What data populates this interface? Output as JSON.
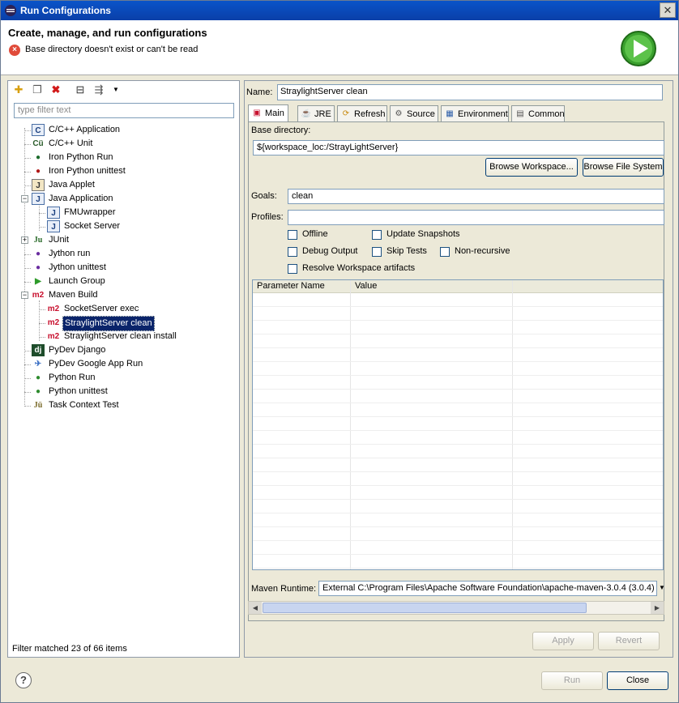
{
  "window": {
    "title": "Run Configurations",
    "close_glyph": "✕"
  },
  "header": {
    "title": "Create, manage, and run configurations",
    "error_message": "Base directory doesn't exist or can't be read"
  },
  "left": {
    "filter_placeholder": "type filter text",
    "footer": "Filter matched 23 of 66 items",
    "tree": [
      {
        "label": "C/C++ Application",
        "icon": "C"
      },
      {
        "label": "C/C++ Unit",
        "icon": "Cü"
      },
      {
        "label": "Iron Python Run",
        "icon": "ironpython-icon"
      },
      {
        "label": "Iron Python unittest",
        "icon": "ironpython-unittest-icon"
      },
      {
        "label": "Java Applet",
        "icon": "applet-icon"
      },
      {
        "label": "Java Application",
        "icon": "J"
      },
      {
        "label": "FMUwrapper",
        "icon": "J"
      },
      {
        "label": "Socket Server",
        "icon": "J"
      },
      {
        "label": "JUnit",
        "icon": "Ju"
      },
      {
        "label": "Jython run",
        "icon": "jython-icon"
      },
      {
        "label": "Jython unittest",
        "icon": "jython-unittest-icon"
      },
      {
        "label": "Launch Group",
        "icon": "play-icon"
      },
      {
        "label": "Maven Build",
        "icon": "m2"
      },
      {
        "label": "SocketServer exec",
        "icon": "m2"
      },
      {
        "label": "StraylightServer clean",
        "icon": "m2"
      },
      {
        "label": "StraylightServer clean install",
        "icon": "m2"
      },
      {
        "label": "PyDev Django",
        "icon": "dj"
      },
      {
        "label": "PyDev Google App Run",
        "icon": "google-app-icon"
      },
      {
        "label": "Python Run",
        "icon": "python-icon"
      },
      {
        "label": "Python unittest",
        "icon": "python-unittest-icon"
      },
      {
        "label": "Task Context Test",
        "icon": "Jü"
      }
    ]
  },
  "right": {
    "name_label": "Name:",
    "name_value": "StraylightServer clean",
    "tabs": [
      {
        "label": "Main",
        "active": true
      },
      {
        "label": "JRE"
      },
      {
        "label": "Refresh"
      },
      {
        "label": "Source"
      },
      {
        "label": "Environment"
      },
      {
        "label": "Common"
      }
    ],
    "base_dir_label": "Base directory:",
    "base_dir_value": "${workspace_loc:/StrayLightServer}",
    "browse_workspace": "Browse Workspace...",
    "browse_fs": "Browse File System",
    "goals_label": "Goals:",
    "goals_value": "clean",
    "profiles_label": "Profiles:",
    "profiles_value": "",
    "checkboxes": {
      "offline": "Offline",
      "update_snapshots": "Update Snapshots",
      "debug_output": "Debug Output",
      "skip_tests": "Skip Tests",
      "non_recursive": "Non-recursive",
      "resolve_ws": "Resolve Workspace artifacts"
    },
    "table": {
      "col1": "Parameter Name",
      "col2": "Value"
    },
    "runtime_label": "Maven Runtime:",
    "runtime_value": "External C:\\Program Files\\Apache Software Foundation\\apache-maven-3.0.4 (3.0.4)",
    "apply": "Apply",
    "revert": "Revert"
  },
  "footer": {
    "run": "Run",
    "close": "Close",
    "help": "?"
  }
}
